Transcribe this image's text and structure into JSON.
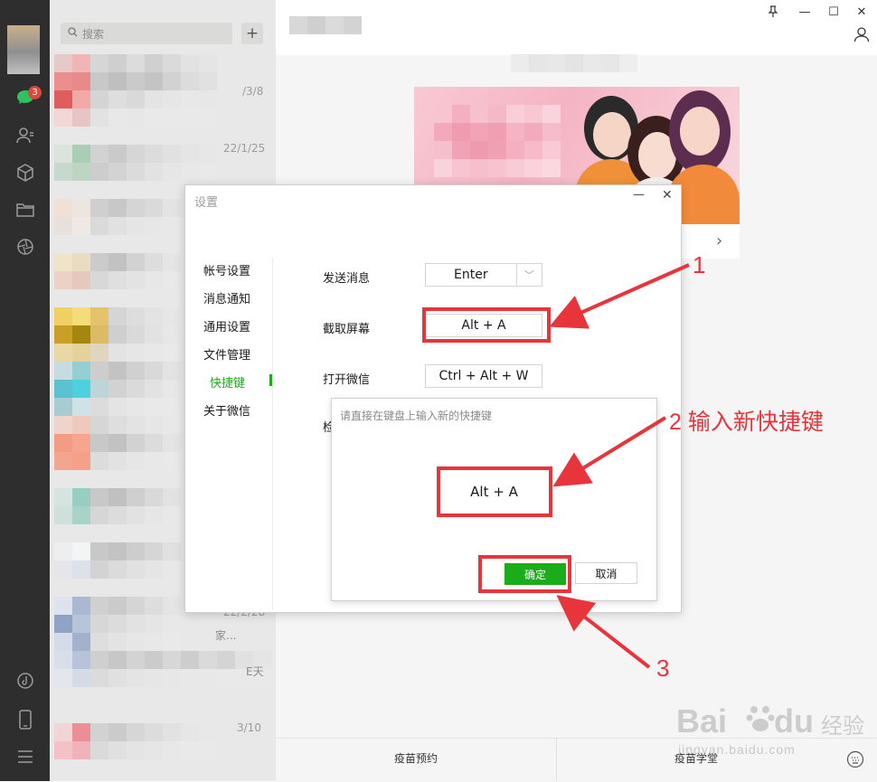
{
  "window": {
    "pin_icon": "pin-icon",
    "minimize_symbol": "—",
    "maximize_symbol": "☐",
    "close_symbol": "✕"
  },
  "sidebar": {
    "badge_count": "3",
    "icons": [
      "chat-icon",
      "contacts-icon",
      "miniprogram-cube-icon",
      "folder-icon",
      "moments-icon",
      "music-icon",
      "phone-icon",
      "menu-icon"
    ]
  },
  "chat_list": {
    "search_placeholder": "搜索",
    "add_symbol": "+",
    "dates": [
      "/3/8",
      "22/1/25",
      "22/2/28",
      "家...",
      "E天",
      "3/10"
    ]
  },
  "chat_pane": {
    "banner_chevron": "›",
    "bottom_tabs": [
      "疫苗预约",
      "疫苗学堂"
    ]
  },
  "settings": {
    "title": "设置",
    "minimize": "—",
    "close": "✕",
    "nav": [
      "帐号设置",
      "消息通知",
      "通用设置",
      "文件管理",
      "快捷键",
      "关于微信"
    ],
    "active_nav": "快捷键",
    "shortcuts": [
      {
        "label": "发送消息",
        "value": "Enter"
      },
      {
        "label": "截取屏幕",
        "value": "Alt + A"
      },
      {
        "label": "打开微信",
        "value": "Ctrl + Alt + W"
      }
    ],
    "partial_label": "检"
  },
  "shortcut_popup": {
    "hint": "请直接在键盘上输入新的快捷键",
    "value": "Alt + A",
    "ok_label": "确定",
    "cancel_label": "取消"
  },
  "annotations": {
    "step1": "1",
    "step2": "2 输入新快捷键",
    "step3": "3",
    "color": "#e8343b"
  },
  "watermark": {
    "brand": "Bai",
    "brand2": "du",
    "brand_cn": "经验",
    "url": "jingyan.baidu.com"
  }
}
